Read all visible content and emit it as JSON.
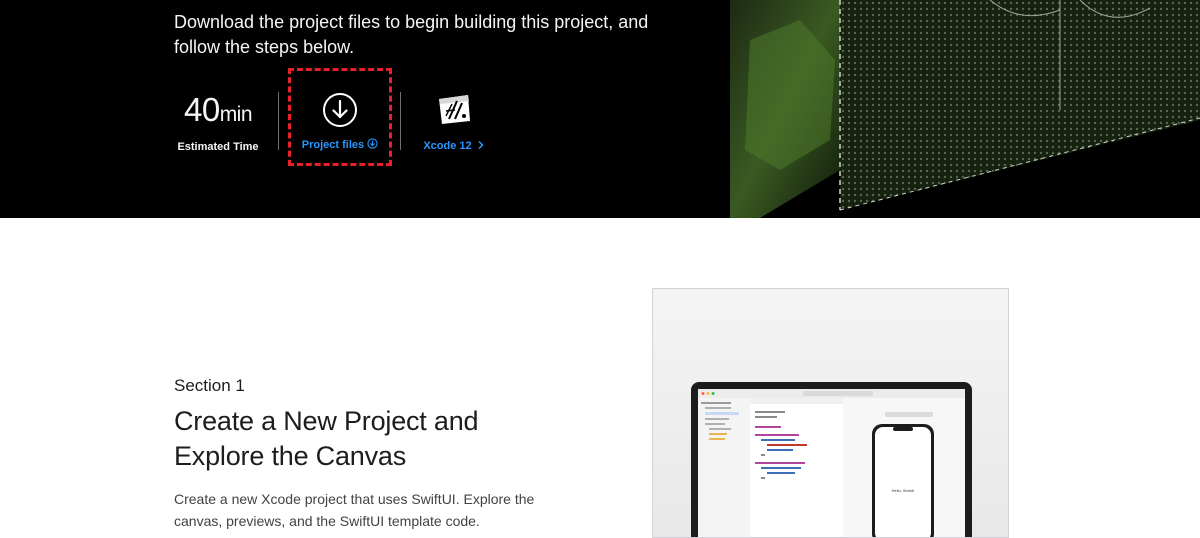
{
  "hero": {
    "intro": "Download the project files to begin building this project, and follow the steps below.",
    "time_value": "40",
    "time_unit": "min",
    "time_caption": "Estimated Time",
    "files_label": "Project files",
    "xcode_label": "Xcode 12",
    "icons": {
      "download": "download-circle-icon",
      "files_arrow": "download-circle-small-icon",
      "xcode": "xcode-icon",
      "chevron": "chevron-right-icon"
    },
    "colors": {
      "link": "#2997ff",
      "highlight": "#e8202a",
      "background": "#000000"
    }
  },
  "section": {
    "eyebrow": "Section 1",
    "title_line1": "Create a New Project and",
    "title_line2": "Explore the Canvas",
    "description": "Create a new Xcode project that uses SwiftUI. Explore the canvas, previews, and the SwiftUI template code."
  },
  "preview": {
    "phone_text": "Hello, World!"
  }
}
